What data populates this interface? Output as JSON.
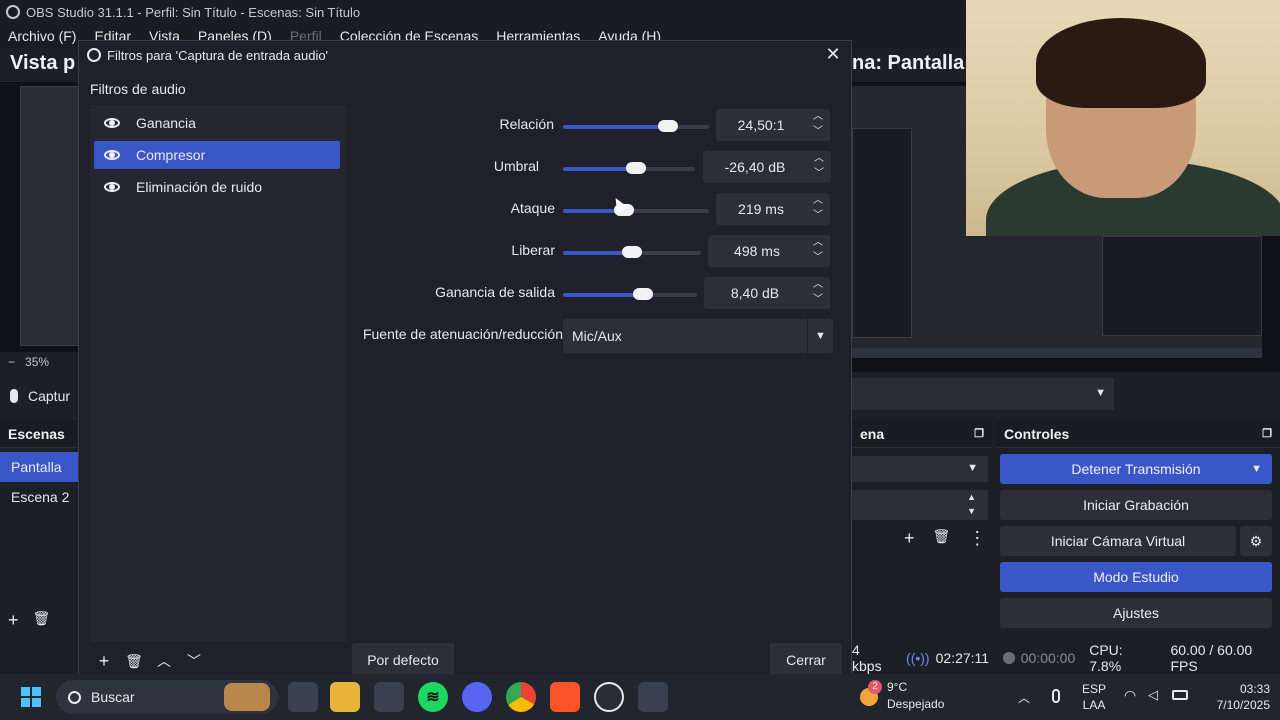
{
  "app": {
    "title": "OBS Studio 31.1.1 - Perfil: Sin Título - Escenas: Sin Título",
    "menu": [
      "Archivo (F)",
      "Editar",
      "Vista",
      "Paneles (D)",
      "Perfil",
      "Colección de Escenas",
      "Herramientas",
      "Ayuda (H)"
    ],
    "preview_title": "Vista p",
    "scene_title": "na: Pantalla",
    "zoom": "35%",
    "source_label": "Captur"
  },
  "escenas": {
    "header": "Escenas",
    "items": [
      "Pantalla",
      "Escena 2"
    ]
  },
  "mixer": {
    "header": "ena"
  },
  "controles": {
    "header": "Controles",
    "buttons": [
      "Detener Transmisión",
      "Iniciar Grabación",
      "Iniciar Cámara Virtual",
      "Modo Estudio",
      "Ajustes"
    ]
  },
  "status": {
    "kbps": "4 kbps",
    "stream_time": "02:27:11",
    "rec_time": "00:00:00",
    "cpu": "CPU: 7.8%",
    "fps": "60.00 / 60.00 FPS"
  },
  "dialog": {
    "title": "Filtros para 'Captura de entrada audio'",
    "section": "Filtros de audio",
    "filters": [
      "Ganancia",
      "Compresor",
      "Eliminación de ruido"
    ],
    "selected_filter": 1,
    "properties": [
      {
        "label": "Relación",
        "value": "24,50:1",
        "level": 0.72
      },
      {
        "label": "Umbral",
        "value": "-26,40 dB",
        "level": 0.55
      },
      {
        "label": "Ataque",
        "value": "219 ms",
        "level": 0.42
      },
      {
        "label": "Liberar",
        "value": "498 ms",
        "level": 0.5
      },
      {
        "label": "Ganancia de salida",
        "value": "8,40 dB",
        "level": 0.6
      }
    ],
    "sidechain": {
      "label": "Fuente de atenuación/reducción",
      "value": "Mic/Aux"
    },
    "defaults_button": "Por defecto",
    "close_button": "Cerrar"
  },
  "taskbar": {
    "search_placeholder": "Buscar",
    "weather_temp": "9°C",
    "weather_desc": "Despejado",
    "weather_badge": "2",
    "lang_top": "ESP",
    "lang_bottom": "LAA",
    "time": "03:33",
    "date": "7/10/2025"
  }
}
